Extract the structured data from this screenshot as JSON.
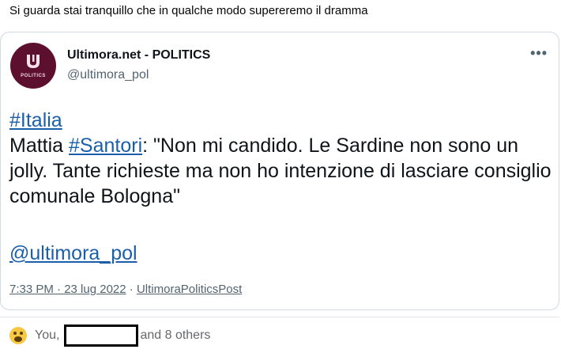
{
  "post": {
    "text": "Si guarda stai tranquillo che in qualche modo supereremo il dramma"
  },
  "embed": {
    "author_name": "Ultimora.net - POLITICS",
    "author_handle": "@ultimora_pol",
    "avatar_label": "POLITICS",
    "more_label": "•••",
    "hashtag_italia": "#Italia",
    "line2_prefix": "Mattia ",
    "hashtag_santori": "#Santori",
    "line2_rest": ": \"Non mi candido. Le Sardine non sono un jolly. Tante richieste ma non ho intenzione di lasciare consiglio comunale Bologna\"",
    "mention": "@ultimora_pol",
    "timestamp": "7:33 PM · 23 lug 2022",
    "separator": " · ",
    "source": "UltimoraPoliticsPost"
  },
  "reactions": {
    "you": "You,",
    "others": "and 8 others"
  },
  "colors": {
    "link": "#1b5faa",
    "avatar_bg": "#5d0f2e",
    "emoji": "#f7c843"
  }
}
